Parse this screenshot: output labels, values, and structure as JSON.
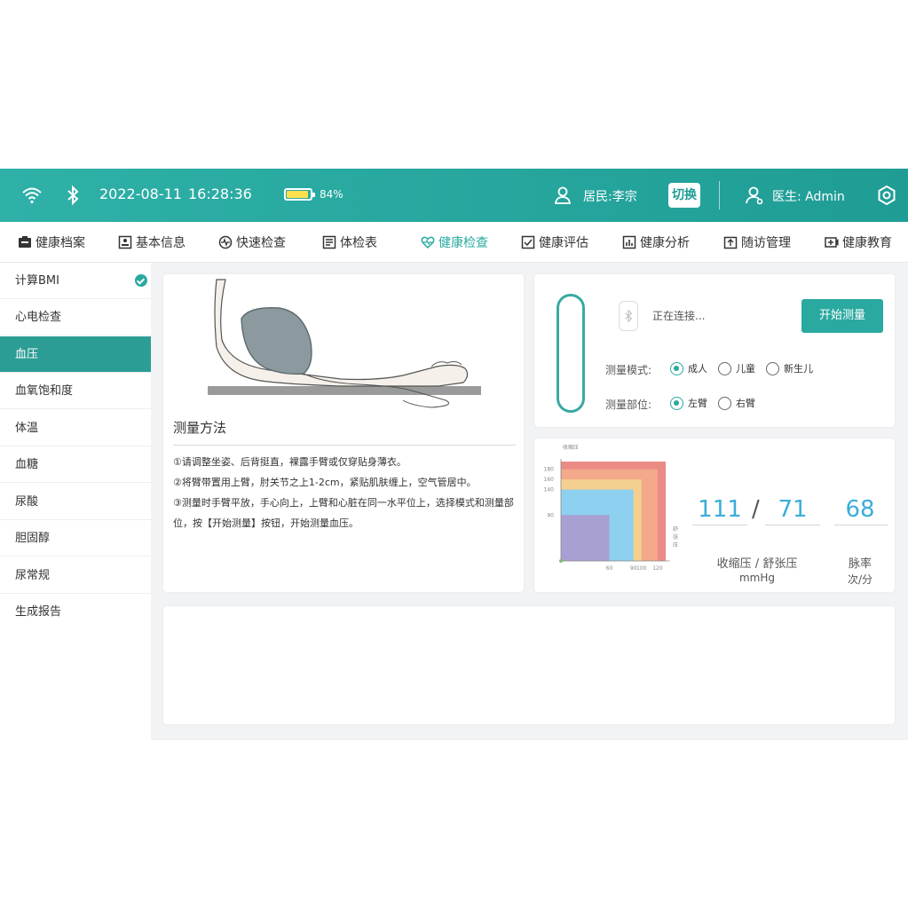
{
  "status": {
    "date": "2022-08-11",
    "time": "16:28:36",
    "battery": "84%",
    "battery_level": 0.84,
    "resident": "居民:李宗",
    "switch_label": "切换",
    "doctor": "医生: Admin"
  },
  "nav": [
    {
      "label": "健康档案",
      "icon": "archive-icon"
    },
    {
      "label": "基本信息",
      "icon": "id-card-icon"
    },
    {
      "label": "快速检查",
      "icon": "pulse-icon"
    },
    {
      "label": "体检表",
      "icon": "form-icon"
    },
    {
      "label": "健康检查",
      "icon": "heart-health-icon",
      "active": true
    },
    {
      "label": "健康评估",
      "icon": "checklist-icon"
    },
    {
      "label": "健康分析",
      "icon": "analysis-icon"
    },
    {
      "label": "随访管理",
      "icon": "followup-icon"
    },
    {
      "label": "健康教育",
      "icon": "education-icon"
    }
  ],
  "sidebar": [
    {
      "label": "计算BMI",
      "done": true
    },
    {
      "label": "心电检查"
    },
    {
      "label": "血压",
      "active": true
    },
    {
      "label": "血氧饱和度"
    },
    {
      "label": "体温"
    },
    {
      "label": "血糖"
    },
    {
      "label": "尿酸"
    },
    {
      "label": "胆固醇"
    },
    {
      "label": "尿常规"
    },
    {
      "label": "生成报告"
    }
  ],
  "method": {
    "title": "测量方法",
    "steps": [
      "①请调整坐姿、后背挺直，裸露手臂或仅穿贴身薄衣。",
      "②将臂带置用上臂，肘关节之上1-2cm，紧贴肌肤缠上，空气管居中。",
      "③测量时手臂平放，手心向上，上臂和心脏在同一水平位上，选择模式和测量部位，按【开始测量】按钮，开始测量血压。"
    ]
  },
  "device": {
    "status": "正在连接...",
    "start_button": "开始测量",
    "mode_label": "测量模式:",
    "mode_options": [
      "成人",
      "儿童",
      "新生儿"
    ],
    "mode_selected": "成人",
    "site_label": "测量部位:",
    "site_options": [
      "左臂",
      "右臂"
    ],
    "site_selected": "左臂"
  },
  "chart_data": {
    "type": "area",
    "ylabel": "收缩压",
    "xlabel": "舒张压",
    "y_ticks": [
      90,
      140,
      160,
      180
    ],
    "x_ticks": [
      60,
      90,
      100,
      120
    ],
    "zones": [
      {
        "x_max": 60,
        "y_max": 90,
        "color": "#a89fd3"
      },
      {
        "x_max": 90,
        "y_max": 140,
        "color": "#8dd0ef"
      },
      {
        "x_max": 100,
        "y_max": 160,
        "color": "#f5cf8f"
      },
      {
        "x_max": 120,
        "y_max": 180,
        "color": "#f3a98a"
      },
      {
        "x_max": 130,
        "y_max": 195,
        "color": "#ec8b86"
      }
    ]
  },
  "reading": {
    "systolic": "111",
    "separator": "/",
    "diastolic": "71",
    "pulse": "68",
    "bp_caption": "收缩压 / 舒张压",
    "bp_unit": "mmHg",
    "pulse_caption": "脉率",
    "pulse_unit": "次/分"
  }
}
